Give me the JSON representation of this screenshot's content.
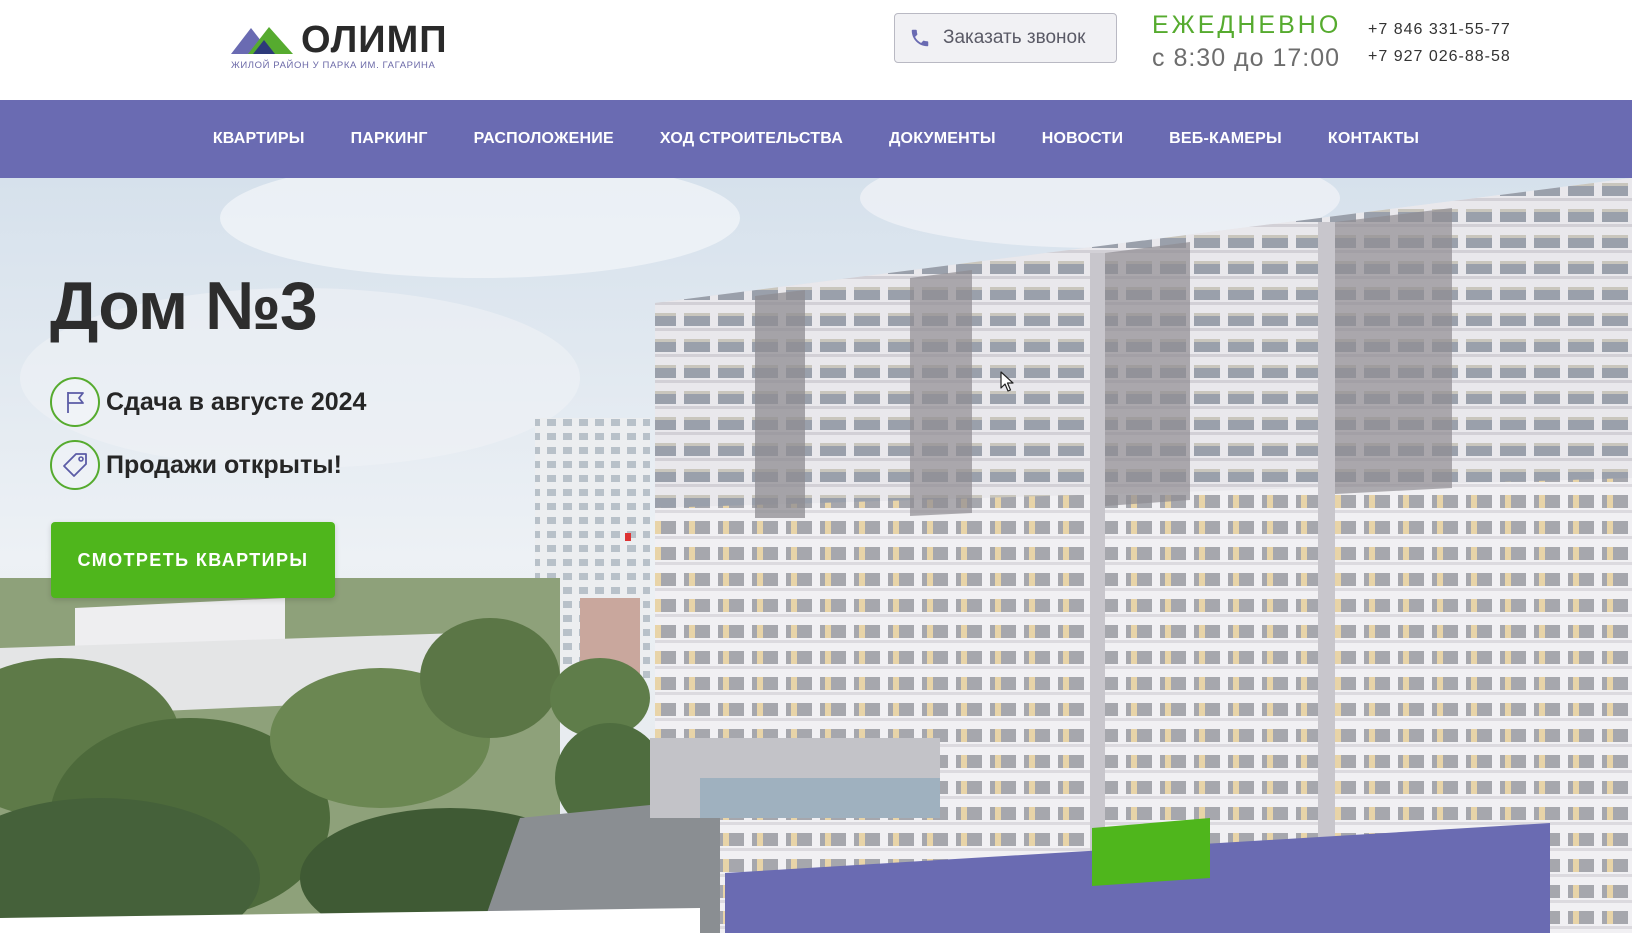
{
  "header": {
    "logo": {
      "name": "ОЛИМП",
      "tagline": "ЖИЛОЙ РАЙОН У ПАРКА ИМ. ГАГАРИНА",
      "icon": "mountain-logo-icon"
    },
    "callback_button": {
      "label": "Заказать звонок",
      "icon": "phone-icon"
    },
    "hours": {
      "days": "ЕЖЕДНЕВНО",
      "time": "с 8:30 до 17:00"
    },
    "phones": [
      "+7 846 331-55-77",
      "+7 927 026-88-58"
    ]
  },
  "nav": {
    "items": [
      {
        "label": "КВАРТИРЫ"
      },
      {
        "label": "ПАРКИНГ"
      },
      {
        "label": "РАСПОЛОЖЕНИЕ"
      },
      {
        "label": "ХОД СТРОИТЕЛЬСТВА"
      },
      {
        "label": "ДОКУМЕНТЫ"
      },
      {
        "label": "НОВОСТИ"
      },
      {
        "label": "ВЕБ-КАМЕРЫ"
      },
      {
        "label": "КОНТАКТЫ"
      }
    ]
  },
  "hero": {
    "title": "Дом №3",
    "features": [
      {
        "text": "Сдача в августе 2024",
        "icon": "flag-icon"
      },
      {
        "text": "Продажи открыты!",
        "icon": "tag-icon"
      }
    ],
    "cta_label": "СМОТРЕТЬ КВАРТИРЫ"
  },
  "colors": {
    "brand_purple": "#6a6bb2",
    "brand_green": "#56ab2f",
    "cta_green": "#4fb61c",
    "text_dark": "#2d2d2d"
  }
}
